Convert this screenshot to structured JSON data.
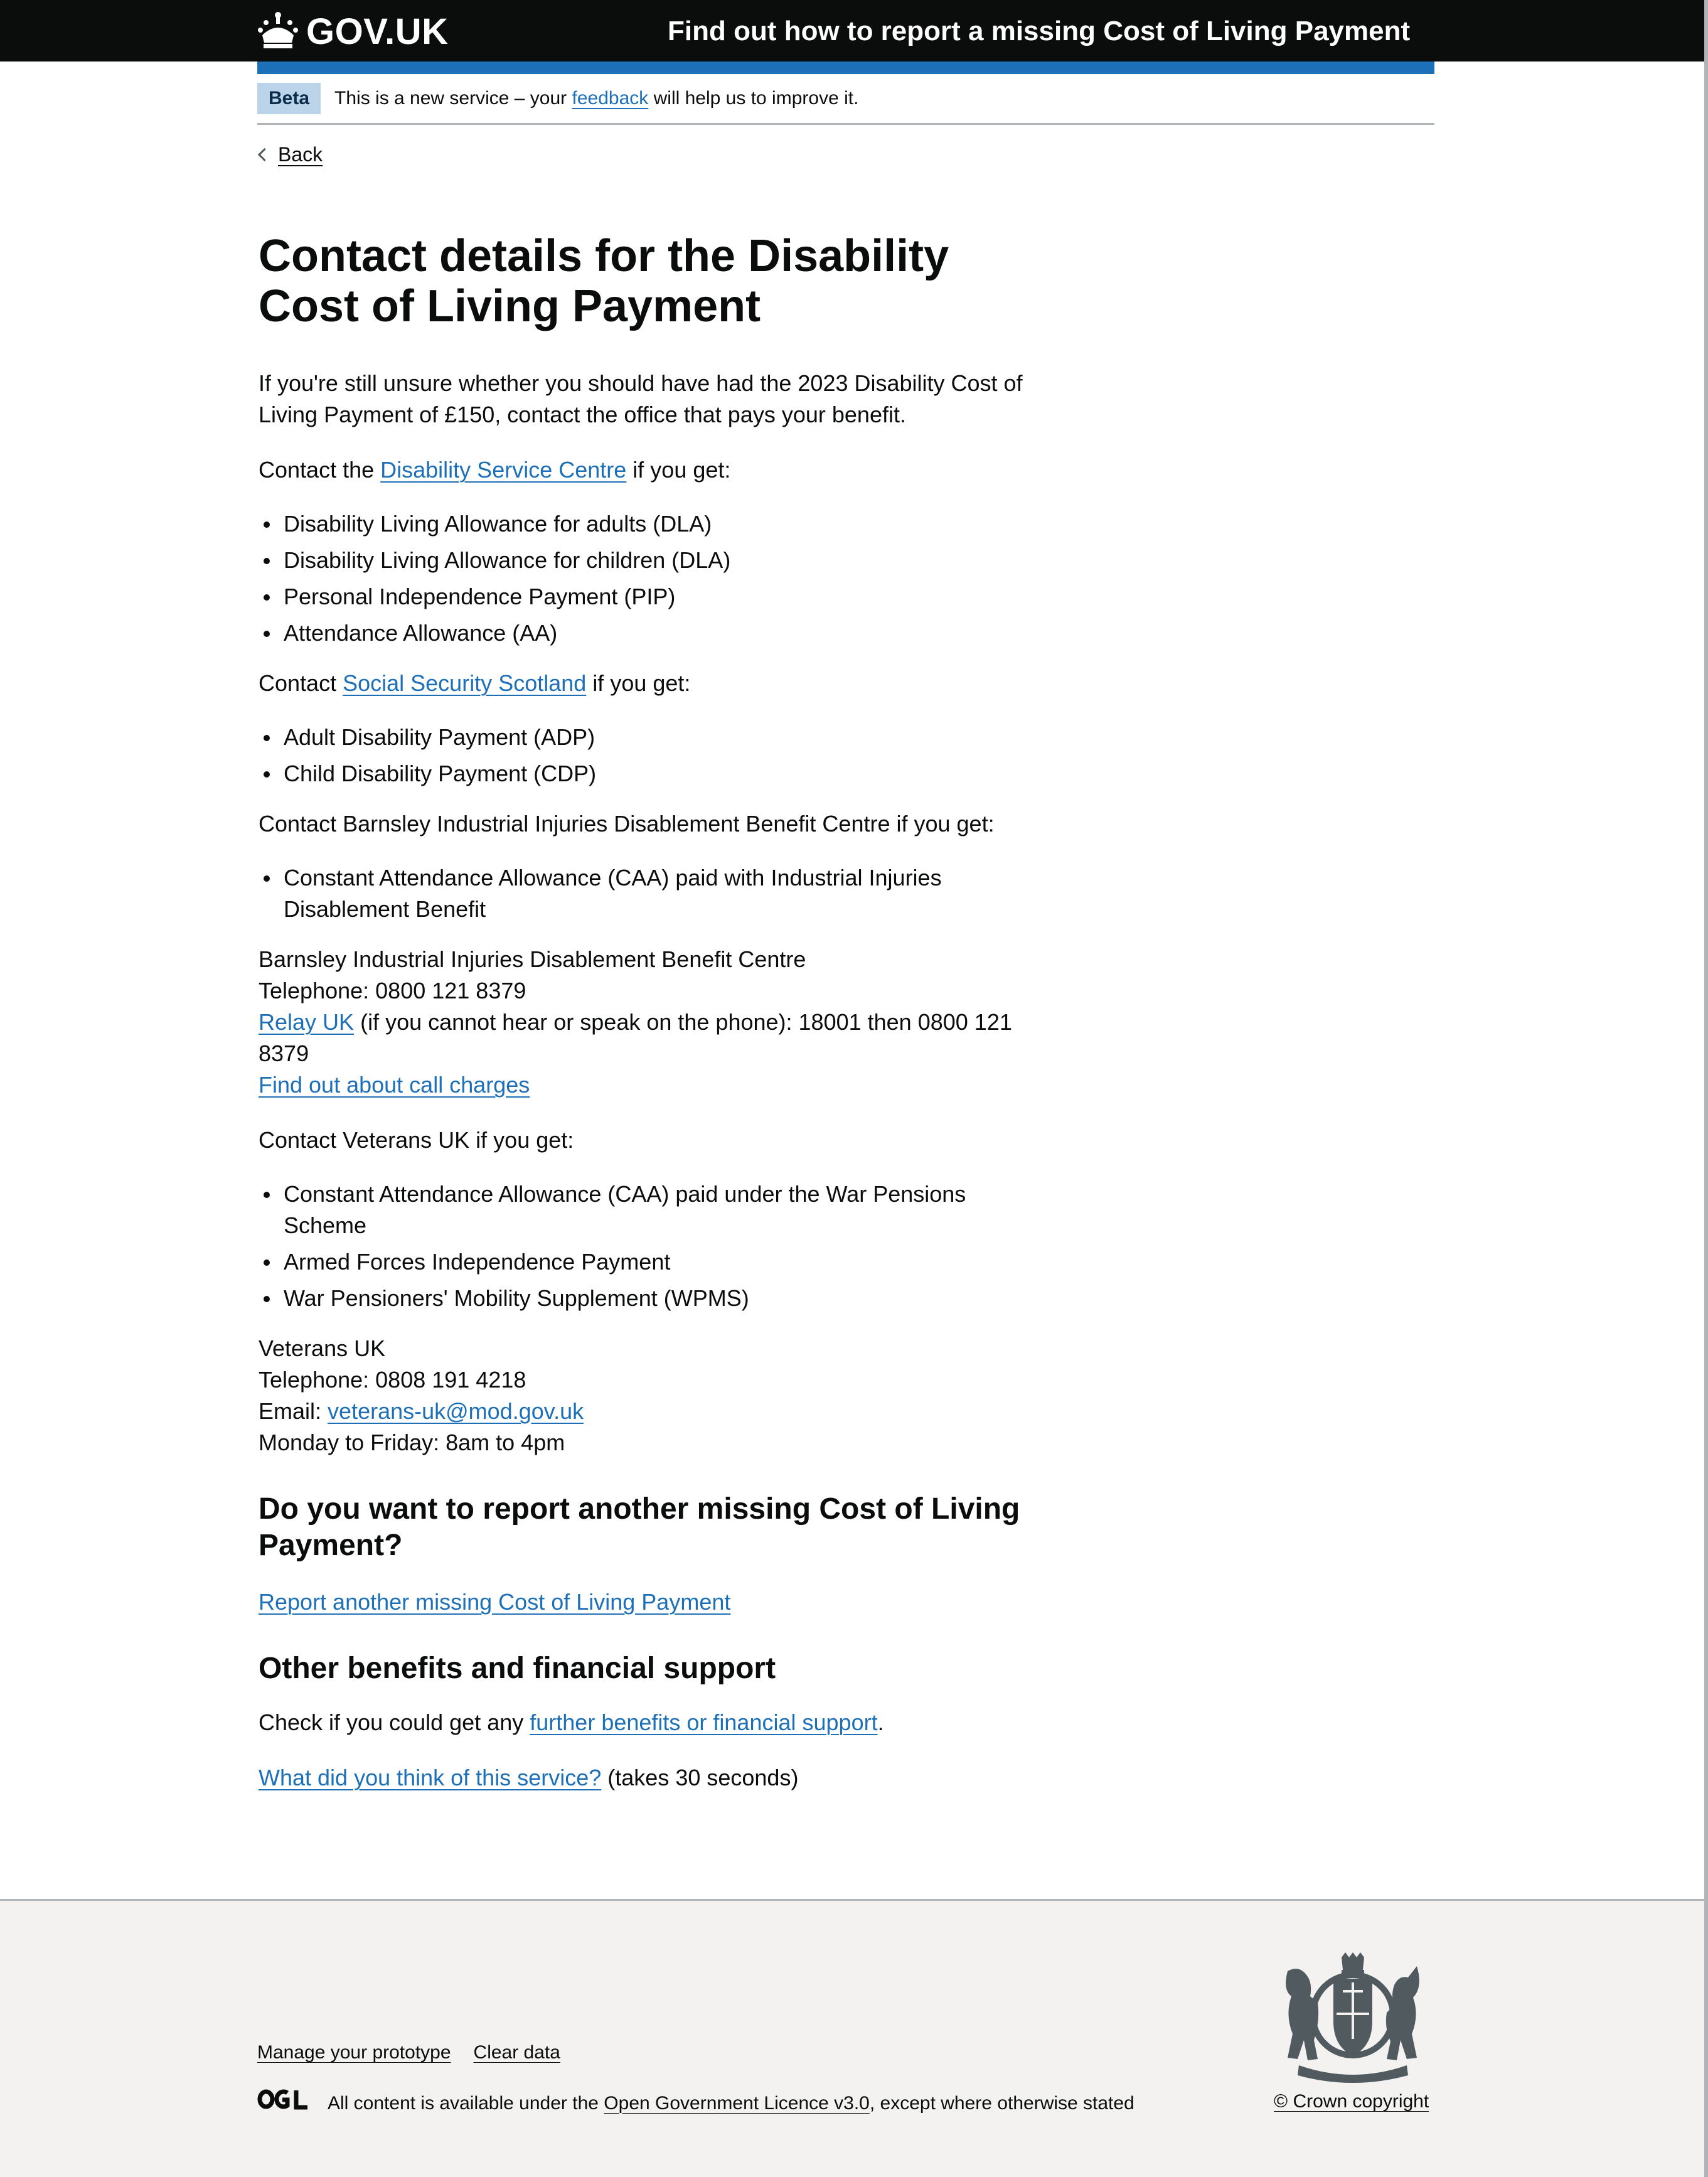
{
  "header": {
    "logo_text": "GOV.UK",
    "service_name": "Find out how to report a missing Cost of Living Payment"
  },
  "phase_banner": {
    "tag": "Beta",
    "text_before": "This is a new service – your",
    "link": "feedback",
    "text_after": "will help us to improve it."
  },
  "back_link": "Back",
  "main": {
    "title": "Contact details for the Disability Cost of Living Payment",
    "intro": "If you're still unsure whether you should have had the 2023 Disability Cost of Living Payment of £150, contact the office that pays your benefit.",
    "dsc": {
      "before": "Contact the",
      "link": "Disability Service Centre",
      "after": "if you get:",
      "items": [
        "Disability Living Allowance for adults (DLA)",
        "Disability Living Allowance for children (DLA)",
        "Personal Independence Payment (PIP)",
        "Attendance Allowance (AA)"
      ]
    },
    "sss": {
      "before": "Contact",
      "link": "Social Security Scotland",
      "after": "if you get:",
      "items": [
        "Adult Disability Payment (ADP)",
        "Child Disability Payment (CDP)"
      ]
    },
    "barnsley": {
      "intro": "Contact Barnsley Industrial Injuries Disablement Benefit Centre if you get:",
      "items": [
        "Constant Attendance Allowance (CAA) paid with Industrial Injuries Disablement Benefit"
      ],
      "name": "Barnsley Industrial Injuries Disablement Benefit Centre",
      "telephone": "Telephone: 0800 121 8379",
      "relay_link": "Relay UK",
      "relay_text": "(if you cannot hear or speak on the phone): 18001 then 0800 121 8379",
      "call_charges_link": "Find out about call charges"
    },
    "veterans": {
      "intro": "Contact Veterans UK if you get:",
      "items": [
        "Constant Attendance Allowance (CAA) paid under the War Pensions Scheme",
        "Armed Forces Independence Payment",
        "War Pensioners' Mobility Supplement (WPMS)"
      ],
      "name": "Veterans UK",
      "telephone": "Telephone: 0808 191 4218",
      "email_label": "Email:",
      "email": "veterans-uk@mod.gov.uk",
      "hours": "Monday to Friday: 8am to 4pm"
    },
    "report_heading": "Do you want to report another missing Cost of Living Payment?",
    "report_link": "Report another missing Cost of Living Payment",
    "other_heading": "Other benefits and financial support",
    "other_before": "Check if you could get any",
    "other_link": "further benefits or financial support",
    "other_after": ".",
    "survey_link": "What did you think of this service?",
    "survey_after": "(takes 30 seconds)"
  },
  "footer": {
    "links": [
      "Manage your prototype",
      "Clear data"
    ],
    "licence_before": "All content is available under the",
    "licence_link": "Open Government Licence v3.0",
    "licence_after": ", except where otherwise stated",
    "copyright": "© Crown copyright"
  },
  "colors": {
    "header_bg": "#0b0c0c",
    "accent_blue": "#1d70b8",
    "tag_bg": "#bbd4ea",
    "footer_bg": "#f3f2f1",
    "text": "#0b0c0c"
  },
  "icons": [
    "crown-icon",
    "chevron-left-icon",
    "ogl-logo-icon",
    "royal-coat-of-arms-icon"
  ]
}
